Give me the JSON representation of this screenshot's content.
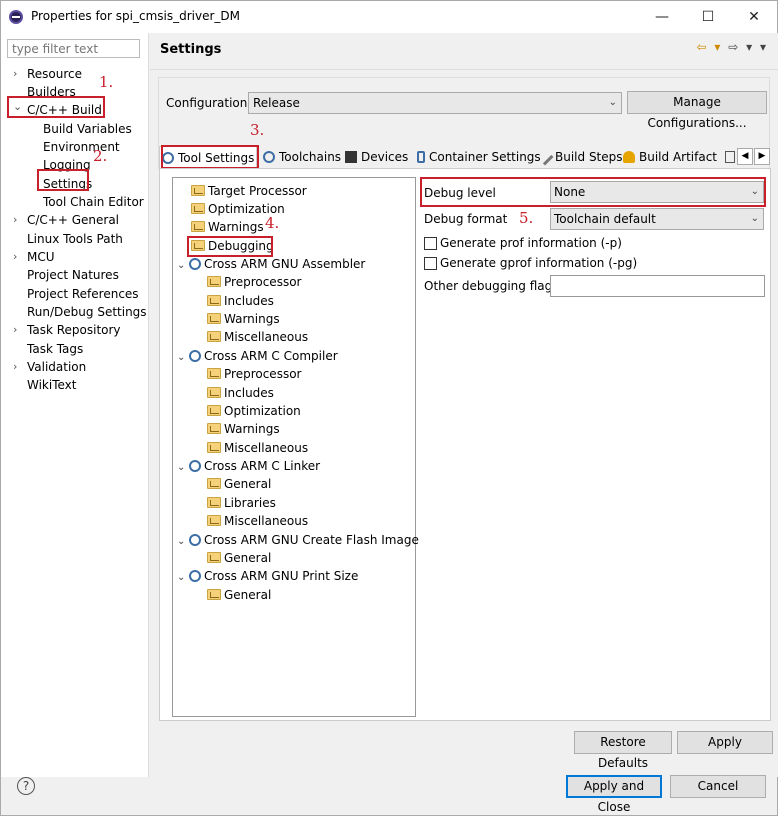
{
  "window": {
    "title": "Properties for spi_cmsis_driver_DM",
    "minimize": "—",
    "maximize": "☐",
    "close": "✕"
  },
  "filter": {
    "placeholder": "type filter text"
  },
  "nav": [
    {
      "label": "Resource",
      "chev": "›"
    },
    {
      "label": "Builders",
      "chev": ""
    },
    {
      "label": "C/C++ Build",
      "chev": "⌄"
    },
    {
      "label": "Build Variables",
      "chev": ""
    },
    {
      "label": "Environment",
      "chev": ""
    },
    {
      "label": "Logging",
      "chev": ""
    },
    {
      "label": "Settings",
      "chev": ""
    },
    {
      "label": "Tool Chain Editor",
      "chev": ""
    },
    {
      "label": "C/C++ General",
      "chev": "›"
    },
    {
      "label": "Linux Tools Path",
      "chev": ""
    },
    {
      "label": "MCU",
      "chev": "›"
    },
    {
      "label": "Project Natures",
      "chev": ""
    },
    {
      "label": "Project References",
      "chev": ""
    },
    {
      "label": "Run/Debug Settings",
      "chev": ""
    },
    {
      "label": "Task Repository",
      "chev": "›"
    },
    {
      "label": "Task Tags",
      "chev": ""
    },
    {
      "label": "Validation",
      "chev": "›"
    },
    {
      "label": "WikiText",
      "chev": ""
    }
  ],
  "header": {
    "title": "Settings",
    "back_icon": "⇦ ▾",
    "fwd_icon": "⇨ ▾ ▾"
  },
  "config": {
    "label": "Configuration:",
    "value": "Release",
    "manage": "Manage Configurations..."
  },
  "tabs": [
    "Tool Settings",
    "Toolchains",
    "Devices",
    "Container Settings",
    "Build Steps",
    "Build Artifact"
  ],
  "tree": [
    {
      "label": "Target Processor",
      "kind": "folder",
      "level": 1
    },
    {
      "label": "Optimization",
      "kind": "folder",
      "level": 1
    },
    {
      "label": "Warnings",
      "kind": "folder",
      "level": 1
    },
    {
      "label": "Debugging",
      "kind": "folder",
      "level": 1
    },
    {
      "label": "Cross ARM GNU Assembler",
      "kind": "tool",
      "level": 0
    },
    {
      "label": "Preprocessor",
      "kind": "folder",
      "level": 2
    },
    {
      "label": "Includes",
      "kind": "folder",
      "level": 2
    },
    {
      "label": "Warnings",
      "kind": "folder",
      "level": 2
    },
    {
      "label": "Miscellaneous",
      "kind": "folder",
      "level": 2
    },
    {
      "label": "Cross ARM C Compiler",
      "kind": "tool",
      "level": 0
    },
    {
      "label": "Preprocessor",
      "kind": "folder",
      "level": 2
    },
    {
      "label": "Includes",
      "kind": "folder",
      "level": 2
    },
    {
      "label": "Optimization",
      "kind": "folder",
      "level": 2
    },
    {
      "label": "Warnings",
      "kind": "folder",
      "level": 2
    },
    {
      "label": "Miscellaneous",
      "kind": "folder",
      "level": 2
    },
    {
      "label": "Cross ARM C Linker",
      "kind": "tool",
      "level": 0
    },
    {
      "label": "General",
      "kind": "folder",
      "level": 2
    },
    {
      "label": "Libraries",
      "kind": "folder",
      "level": 2
    },
    {
      "label": "Miscellaneous",
      "kind": "folder",
      "level": 2
    },
    {
      "label": "Cross ARM GNU Create Flash Image",
      "kind": "tool",
      "level": 0
    },
    {
      "label": "General",
      "kind": "folder",
      "level": 2
    },
    {
      "label": "Cross ARM GNU Print Size",
      "kind": "tool",
      "level": 0
    },
    {
      "label": "General",
      "kind": "folder",
      "level": 2
    }
  ],
  "options": {
    "debug_level_label": "Debug level",
    "debug_level_value": "None",
    "debug_format_label": "Debug format",
    "debug_format_value": "Toolchain default",
    "prof_label": "Generate prof information (-p)",
    "gprof_label": "Generate gprof information (-pg)",
    "other_label": "Other debugging flags",
    "other_value": ""
  },
  "annotations": [
    "1.",
    "2.",
    "3.",
    "4.",
    "5."
  ],
  "buttons": {
    "restore": "Restore Defaults",
    "apply": "Apply",
    "apply_close": "Apply and Close",
    "cancel": "Cancel",
    "help": "?"
  },
  "colors": {
    "annotation": "#c8202a",
    "accent": "#0078d7"
  }
}
